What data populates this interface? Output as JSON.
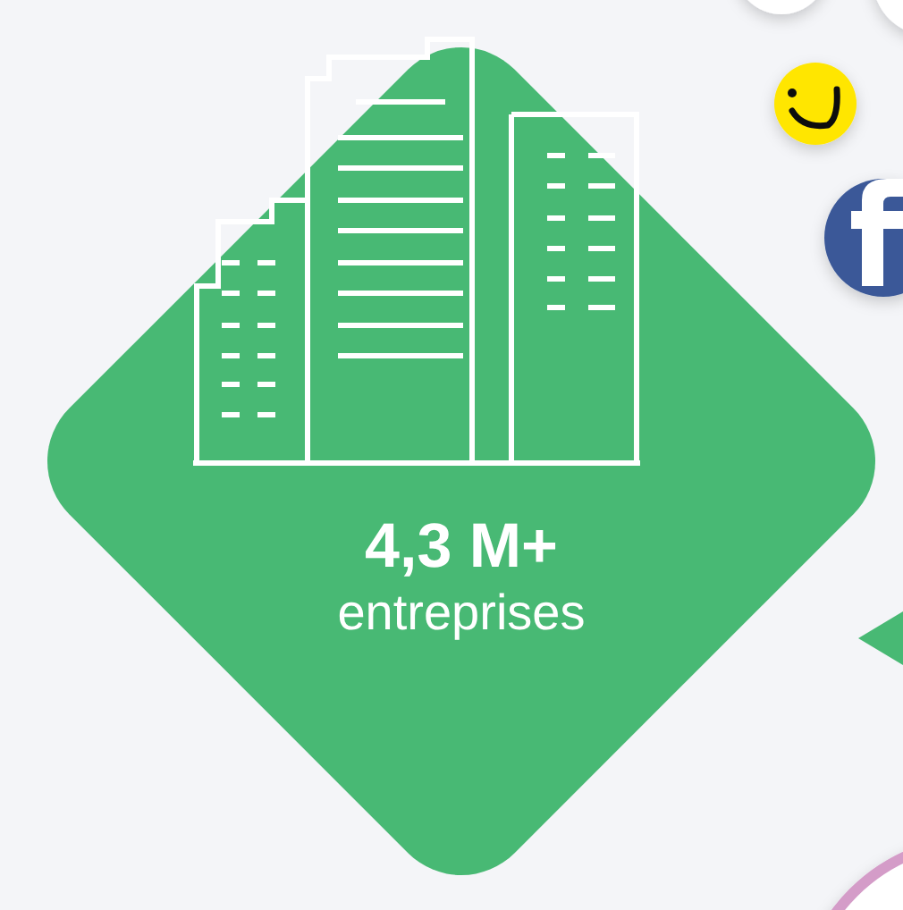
{
  "stat": {
    "value": "4,3 M+",
    "label": "entreprises"
  }
}
